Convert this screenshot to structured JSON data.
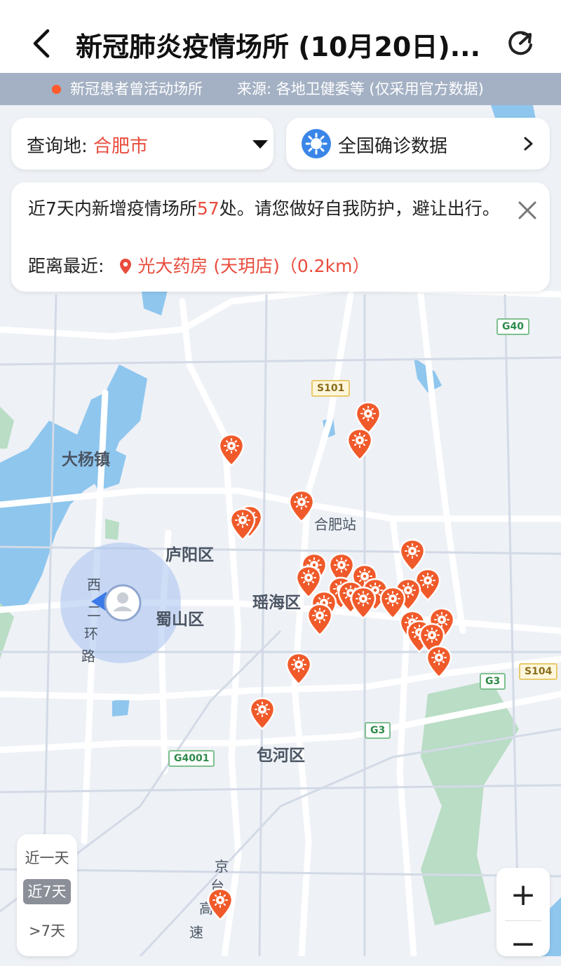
{
  "header": {
    "title": "新冠肺炎疫情场所 (10月20日)...",
    "back_icon": "chevron-left-icon",
    "refresh_icon": "refresh-icon"
  },
  "info_bar": {
    "legend_text": "新冠患者曾活动场所",
    "source_text": "来源: 各地卫健委等 (仅采用官方数据)",
    "dot_color": "#ff5a2c"
  },
  "city_select": {
    "label": "查询地: ",
    "value": "合肥市"
  },
  "national_data": {
    "label": "全国确诊数据"
  },
  "notice": {
    "prefix": "近7天内新增疫情场所",
    "count": "57",
    "suffix": "处。请您做好自我防护，避让出行。",
    "nearest_label": "距离最近: ",
    "nearest_place": "光大药房 (天玥店)（0.2km）"
  },
  "map": {
    "labels": {
      "dayang": "大杨镇",
      "luyang": "庐阳区",
      "yaohai": "瑶海区",
      "shushan": "蜀山区",
      "baohe": "包河区",
      "hefei_station": "合肥站",
      "xi": "西",
      "er": "二",
      "huan": "环",
      "lu": "路",
      "jing": "京",
      "tai": "台",
      "gao": "高",
      "su": "速"
    },
    "shields": {
      "s101": "S101",
      "g40": "G40",
      "g3a": "G3",
      "s104": "S104",
      "g3b": "G3",
      "g4001": "G4001"
    },
    "colors": {
      "marker": "#f05a2a",
      "water": "#8ec6ee",
      "green": "#b9ddc5",
      "road": "#ffffff",
      "background": "#eef1f6"
    }
  },
  "time_tabs": [
    "近一天",
    "近7天",
    ">7天"
  ],
  "time_tabs_active": "近7天",
  "zoom": {
    "in": "+",
    "out": "−"
  }
}
